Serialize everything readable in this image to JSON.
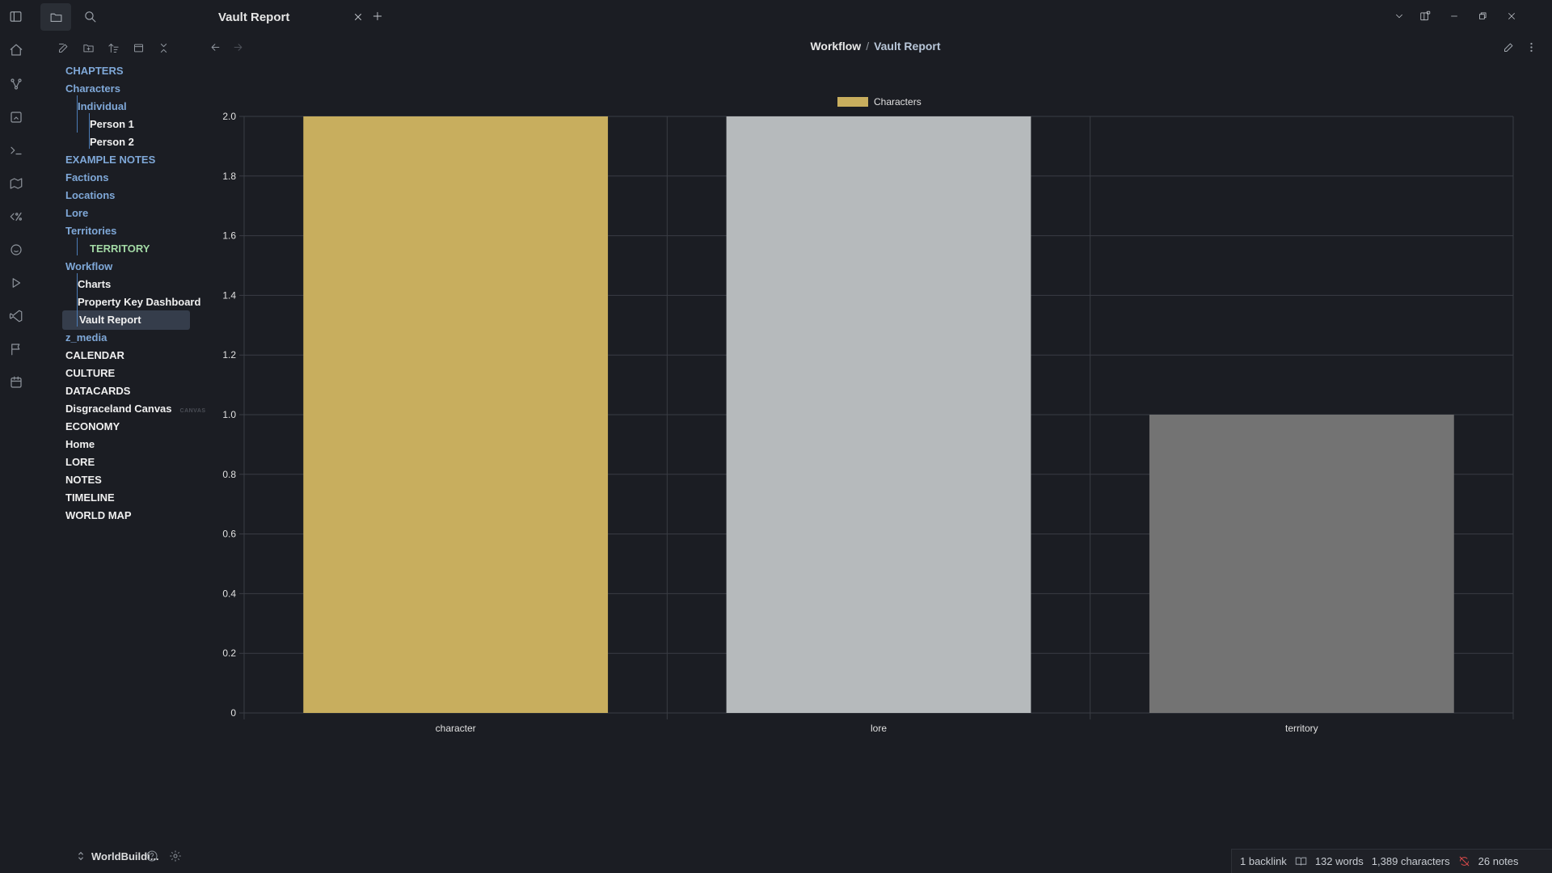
{
  "ribbon": {
    "icons": [
      "home-icon",
      "graph-icon",
      "canvas-icon",
      "terminal-icon",
      "map-icon",
      "percent-code-icon",
      "smile-icon",
      "play-icon",
      "vscode-icon",
      "flag-icon",
      "calendar-icon"
    ]
  },
  "sidebar": {
    "top_icons": [
      "sidebar-toggle-icon",
      "folder-icon",
      "search-icon"
    ],
    "nav_icons": [
      "new-note-icon",
      "new-folder-icon",
      "sort-icon",
      "collapse-view-icon",
      "collapse-all-icon"
    ],
    "tree": [
      {
        "label": "CHAPTERS",
        "kind": "folder",
        "level": 0
      },
      {
        "label": "Characters",
        "kind": "folder",
        "level": 0
      },
      {
        "label": "Individual",
        "kind": "folder",
        "level": 1
      },
      {
        "label": "Person 1",
        "kind": "file",
        "level": 2
      },
      {
        "label": "Person 2",
        "kind": "file",
        "level": 2
      },
      {
        "label": "EXAMPLE NOTES",
        "kind": "folder",
        "level": 0
      },
      {
        "label": "Factions",
        "kind": "folder",
        "level": 0
      },
      {
        "label": "Locations",
        "kind": "folder",
        "level": 0
      },
      {
        "label": "Lore",
        "kind": "folder",
        "level": 0
      },
      {
        "label": "Territories",
        "kind": "folder",
        "level": 0
      },
      {
        "label": "TERRITORY",
        "kind": "green",
        "level": 2
      },
      {
        "label": "Workflow",
        "kind": "folder",
        "level": 0
      },
      {
        "label": "Charts",
        "kind": "file",
        "level": 1
      },
      {
        "label": "Property Key Dashboard",
        "kind": "file",
        "level": 1
      },
      {
        "label": "Vault Report",
        "kind": "file",
        "level": 1,
        "active": true
      },
      {
        "label": "z_media",
        "kind": "folder",
        "level": 0
      },
      {
        "label": "CALENDAR",
        "kind": "file",
        "level": 0
      },
      {
        "label": "CULTURE",
        "kind": "file",
        "level": 0
      },
      {
        "label": "DATACARDS",
        "kind": "file",
        "level": 0
      },
      {
        "label": "Disgraceland Canvas",
        "kind": "file",
        "level": 0,
        "tag": "CANVAS"
      },
      {
        "label": "ECONOMY",
        "kind": "file",
        "level": 0
      },
      {
        "label": "Home",
        "kind": "file",
        "level": 0
      },
      {
        "label": "LORE",
        "kind": "file",
        "level": 0
      },
      {
        "label": "NOTES",
        "kind": "file",
        "level": 0
      },
      {
        "label": "TIMELINE",
        "kind": "file",
        "level": 0
      },
      {
        "label": "WORLD MAP",
        "kind": "file",
        "level": 0
      }
    ],
    "vault_name": "WorldBuildi...",
    "bottom_icons": [
      "help-icon",
      "settings-icon"
    ]
  },
  "tabbar": {
    "active_tab": "Vault Report"
  },
  "header": {
    "breadcrumb_parent": "Workflow",
    "breadcrumb_sep": "/",
    "breadcrumb_current": "Vault Report"
  },
  "chart_data": {
    "type": "bar",
    "categories": [
      "character",
      "lore",
      "territory"
    ],
    "series": [
      {
        "name": "Characters",
        "values": [
          2,
          2,
          1
        ]
      }
    ],
    "bar_colors": [
      "#c8ae5e",
      "#b6babc",
      "#737373"
    ],
    "legend_color": "#c8ae5e",
    "ylim": [
      0,
      2
    ],
    "yticks": [
      "0",
      "0.2",
      "0.4",
      "0.6",
      "0.8",
      "1.0",
      "1.2",
      "1.4",
      "1.6",
      "1.8",
      "2.0"
    ],
    "grid": true,
    "legend": "top-center"
  },
  "statusbar": {
    "backlinks": "1 backlink",
    "words": "132 words",
    "characters": "1,389 characters",
    "notes": "26 notes"
  }
}
